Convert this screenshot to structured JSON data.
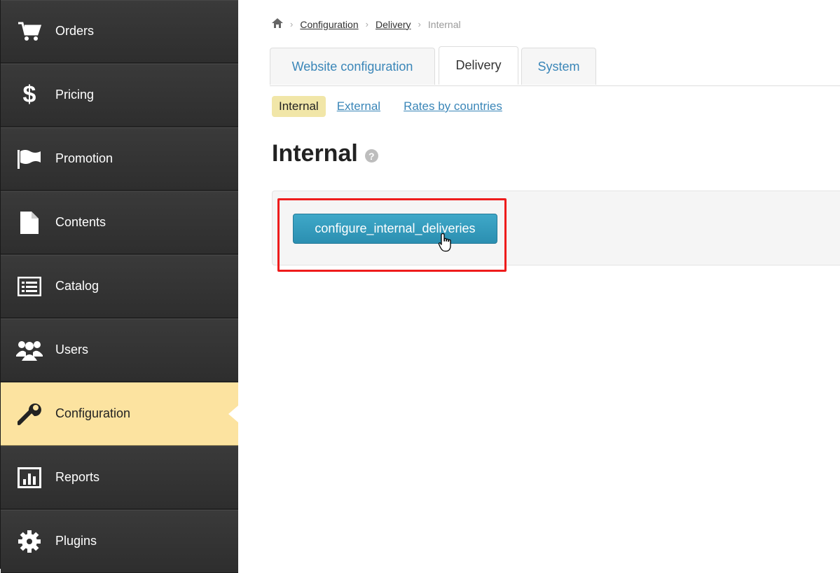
{
  "sidebar": {
    "items": [
      {
        "label": "Orders",
        "icon": "cart-icon"
      },
      {
        "label": "Pricing",
        "icon": "dollar-icon"
      },
      {
        "label": "Promotion",
        "icon": "flag-icon"
      },
      {
        "label": "Contents",
        "icon": "document-icon"
      },
      {
        "label": "Catalog",
        "icon": "list-icon"
      },
      {
        "label": "Users",
        "icon": "users-icon"
      },
      {
        "label": "Configuration",
        "icon": "wrench-icon",
        "active": true
      },
      {
        "label": "Reports",
        "icon": "bar-chart-icon"
      },
      {
        "label": "Plugins",
        "icon": "gear-icon"
      }
    ]
  },
  "breadcrumb": {
    "home_icon": "home-icon",
    "items": [
      "Configuration",
      "Delivery"
    ],
    "current": "Internal"
  },
  "tabs": [
    {
      "label": "Website configuration"
    },
    {
      "label": "Delivery",
      "active": true
    },
    {
      "label": "System"
    }
  ],
  "subnav": {
    "active": "Internal",
    "links": [
      "External",
      "Rates by countries"
    ]
  },
  "page": {
    "title": "Internal",
    "help_icon": "question-icon"
  },
  "action": {
    "button_label": "configure_internal_deliveries"
  },
  "colors": {
    "sidebar_bg": "#2f2f2f",
    "sidebar_active": "#fce3a0",
    "link": "#3a86b8",
    "button": "#2b8fb1",
    "highlight": "#ee1c1c"
  }
}
